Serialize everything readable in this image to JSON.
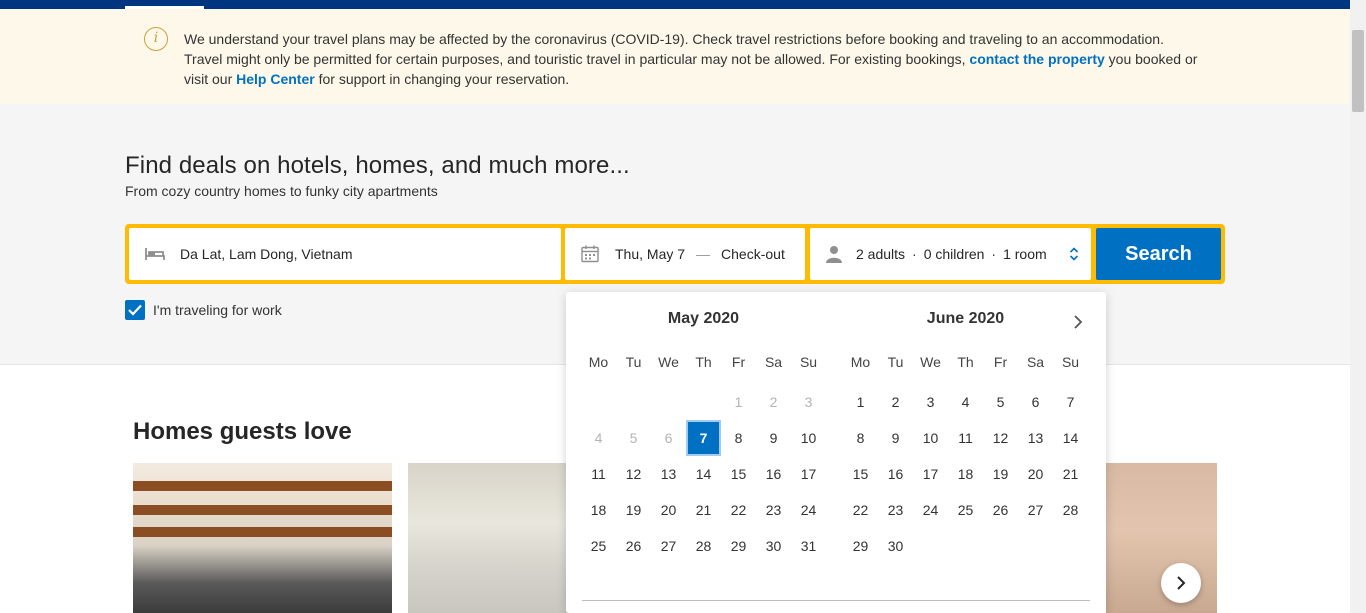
{
  "notice": {
    "text_1": "We understand your travel plans may be affected by the coronavirus (COVID-19). Check travel restrictions before booking and traveling to an accommodation. Travel might only be permitted for certain purposes, and touristic travel in particular may not be allowed. For existing bookings, ",
    "link_contact": "contact the property",
    "text_2": " you booked or visit our ",
    "link_help": "Help Center",
    "text_3": " for support in changing your reservation."
  },
  "hero": {
    "title": "Find deals on hotels, homes, and much more...",
    "subtitle": "From cozy country homes to funky city apartments"
  },
  "search": {
    "destination": "Da Lat, Lam Dong, Vietnam",
    "checkin": "Thu, May 7",
    "dash": "—",
    "checkout": "Check-out",
    "adults": "2 adults",
    "children": "0 children",
    "rooms": "1 room",
    "separator": "·",
    "button": "Search"
  },
  "work_travel": {
    "label": "I'm traveling for work",
    "checked": true
  },
  "calendar": {
    "weekdays": [
      "Mo",
      "Tu",
      "We",
      "Th",
      "Fr",
      "Sa",
      "Su"
    ],
    "months": [
      {
        "title": "May 2020",
        "offset": 4,
        "days": 31,
        "disabled_before": 7,
        "selected": 7
      },
      {
        "title": "June 2020",
        "offset": 0,
        "days": 30,
        "disabled_before": 0,
        "selected": null
      }
    ]
  },
  "homes": {
    "title": "Homes guests love"
  },
  "colors": {
    "brand_blue": "#003580",
    "accent_blue": "#0071c2",
    "searchbox_yellow": "#febb02",
    "notice_bg": "#fef8ea"
  },
  "icons": {
    "notice": "info-icon",
    "destination": "bed-icon",
    "dates": "calendar-icon",
    "guests": "person-icon",
    "guests_toggle": "updown-chevron-icon",
    "calendar_next": "chevron-right-icon",
    "carousel_next": "chevron-right-icon",
    "checkbox": "checkmark-icon"
  }
}
